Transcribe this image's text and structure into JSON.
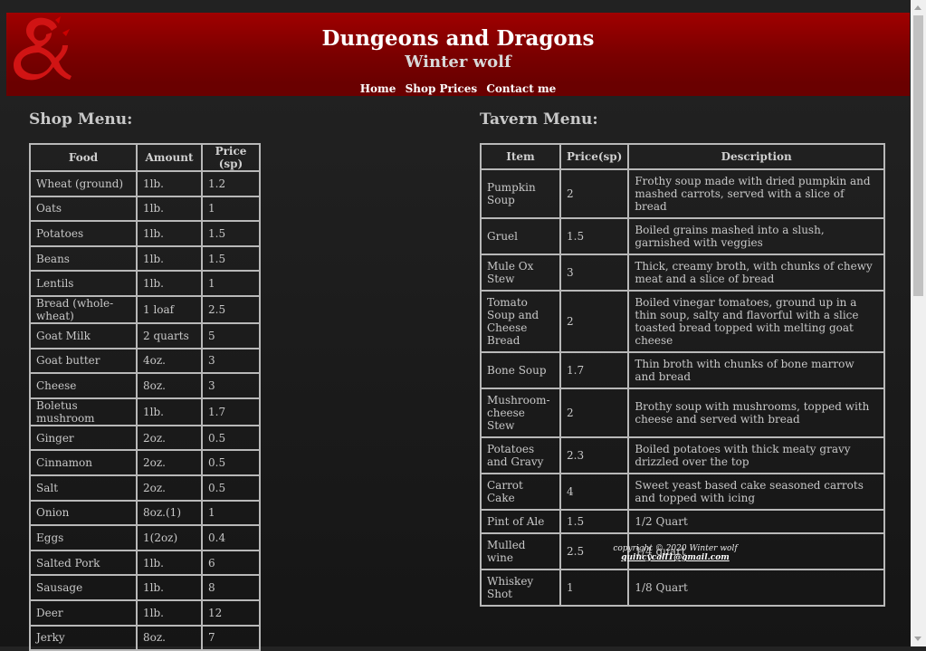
{
  "header": {
    "title": "Dungeons and Dragons",
    "subtitle": "Winter wolf",
    "logo_icon": "ampersand-dragon-logo",
    "accent": "#8b0000"
  },
  "nav": {
    "items": [
      "Home",
      "Shop Prices",
      "Contact me"
    ]
  },
  "shop": {
    "title": "Shop Menu:",
    "columns": [
      "Food",
      "Amount",
      "Price (sp)"
    ],
    "rows": [
      [
        "Wheat (ground)",
        "1lb.",
        "1.2"
      ],
      [
        "Oats",
        "1lb.",
        "1"
      ],
      [
        "Potatoes",
        "1lb.",
        "1.5"
      ],
      [
        "Beans",
        "1lb.",
        "1.5"
      ],
      [
        "Lentils",
        "1lb.",
        "1"
      ],
      [
        "Bread (whole-wheat)",
        "1 loaf",
        "2.5"
      ],
      [
        "Goat Milk",
        "2 quarts",
        "5"
      ],
      [
        "Goat butter",
        "4oz.",
        "3"
      ],
      [
        "Cheese",
        "8oz.",
        "3"
      ],
      [
        "Boletus mushroom",
        "1lb.",
        "1.7"
      ],
      [
        "Ginger",
        "2oz.",
        "0.5"
      ],
      [
        "Cinnamon",
        "2oz.",
        "0.5"
      ],
      [
        "Salt",
        "2oz.",
        "0.5"
      ],
      [
        "Onion",
        "8oz.(1)",
        "1"
      ],
      [
        "Eggs",
        "1(2oz)",
        "0.4"
      ],
      [
        "Salted Pork",
        "1lb.",
        "6"
      ],
      [
        "Sausage",
        "1lb.",
        "8"
      ],
      [
        "Deer",
        "1lb.",
        "12"
      ],
      [
        "Jerky",
        "8oz.",
        "7"
      ]
    ]
  },
  "tavern": {
    "title": "Tavern Menu:",
    "columns": [
      "Item",
      "Price(sp)",
      "Description"
    ],
    "rows": [
      [
        "Pumpkin Soup",
        "2",
        "Frothy soup made with dried pumpkin and mashed carrots, served with a slice of bread"
      ],
      [
        "Gruel",
        "1.5",
        "Boiled grains mashed into a slush, garnished with veggies"
      ],
      [
        "Mule Ox Stew",
        "3",
        "Thick, creamy broth, with chunks of chewy meat and a slice of bread"
      ],
      [
        "Tomato Soup and Cheese Bread",
        "2",
        "Boiled vinegar tomatoes, ground up in a thin soup, salty and flavorful with a slice toasted bread topped with melting goat cheese"
      ],
      [
        "Bone Soup",
        "1.7",
        "Thin broth with chunks of bone marrow and bread"
      ],
      [
        "Mushroom-cheese Stew",
        "2",
        "Brothy soup with mushrooms, topped with cheese and served with bread"
      ],
      [
        "Potatoes and Gravy",
        "2.3",
        "Boiled potatoes with thick meaty gravy drizzled over the top"
      ],
      [
        "Carrot Cake",
        "4",
        "Sweet yeast based cake seasoned carrots and topped with icing"
      ],
      [
        "Pint of Ale",
        "1.5",
        "1/2 Quart"
      ],
      [
        "Mulled wine",
        "2.5",
        "1/4 quart"
      ],
      [
        "Whiskey Shot",
        "1",
        "1/8 Quart"
      ]
    ]
  },
  "footer": {
    "copyright": "copyright © 2020 Winter wolf",
    "email": "quincycall1@gmail.com"
  }
}
